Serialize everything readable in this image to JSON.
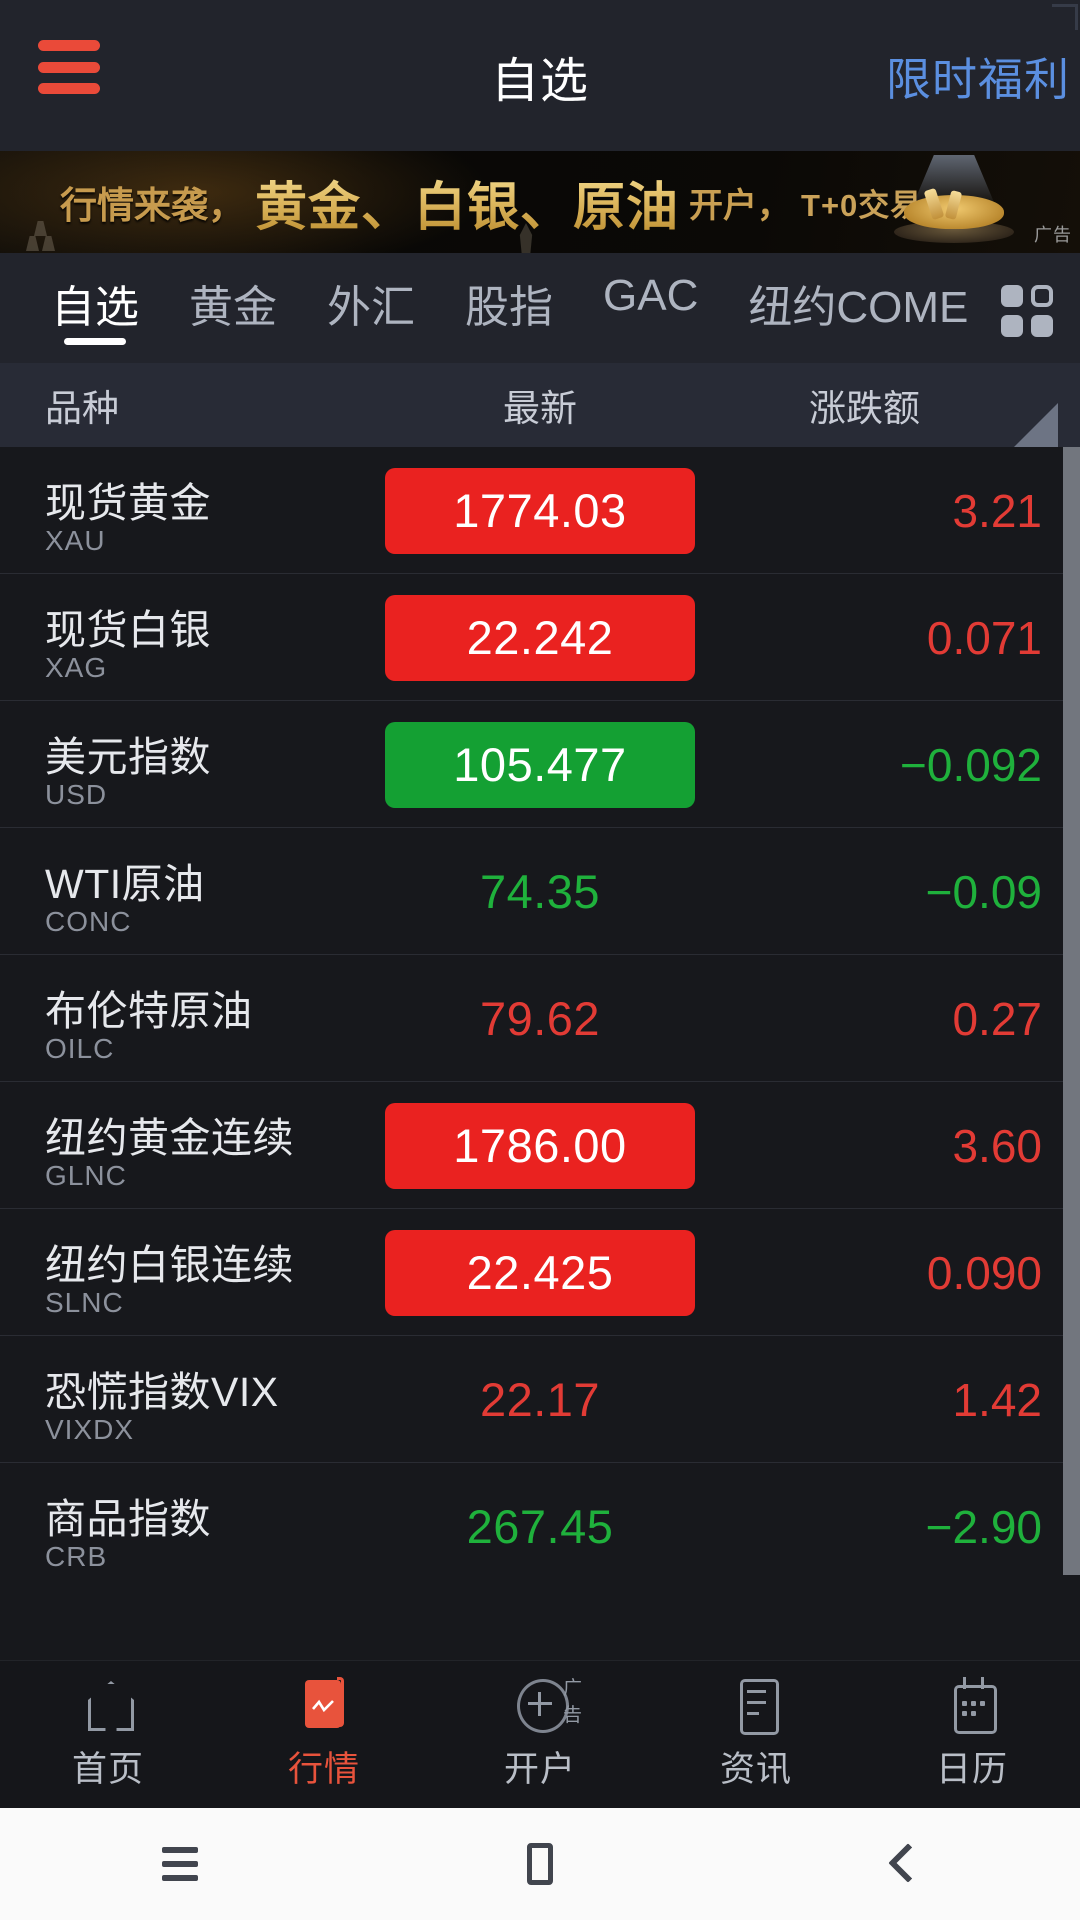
{
  "topbar": {
    "menu_icon": "hamburger-icon",
    "title": "自选",
    "promo_label": "限时福利"
  },
  "ad_banner": {
    "text_1": "行情来袭，",
    "text_2": "黄金、白银、原油",
    "text_3": "开户，",
    "text_4": "T+0交易",
    "badge": "广告"
  },
  "category_tabs": {
    "items": [
      {
        "label": "自选",
        "active": true
      },
      {
        "label": "黄金",
        "active": false
      },
      {
        "label": "外汇",
        "active": false
      },
      {
        "label": "股指",
        "active": false
      },
      {
        "label": "GAC",
        "active": false
      },
      {
        "label": "纽约COME",
        "active": false
      }
    ],
    "chevron": "›",
    "grid_icon": "grid-view-icon"
  },
  "table": {
    "headers": {
      "name": "品种",
      "last": "最新",
      "change": "涨跌额"
    },
    "rows": [
      {
        "name": "现货黄金",
        "code": "XAU",
        "price": "1774.03",
        "change": "3.21",
        "dir": "up",
        "pill": true
      },
      {
        "name": "现货白银",
        "code": "XAG",
        "price": "22.242",
        "change": "0.071",
        "dir": "up",
        "pill": true
      },
      {
        "name": "美元指数",
        "code": "USD",
        "price": "105.477",
        "change": "−0.092",
        "dir": "down",
        "pill": true
      },
      {
        "name": "WTI原油",
        "code": "CONC",
        "price": "74.35",
        "change": "−0.09",
        "dir": "down",
        "pill": false
      },
      {
        "name": "布伦特原油",
        "code": "OILC",
        "price": "79.62",
        "change": "0.27",
        "dir": "up",
        "pill": false
      },
      {
        "name": "纽约黄金连续",
        "code": "GLNC",
        "price": "1786.00",
        "change": "3.60",
        "dir": "up",
        "pill": true
      },
      {
        "name": "纽约白银连续",
        "code": "SLNC",
        "price": "22.425",
        "change": "0.090",
        "dir": "up",
        "pill": true
      },
      {
        "name": "恐慌指数VIX",
        "code": "VIXDX",
        "price": "22.17",
        "change": "1.42",
        "dir": "up",
        "pill": false
      },
      {
        "name": "商品指数",
        "code": "CRB",
        "price": "267.45",
        "change": "−2.90",
        "dir": "down",
        "pill": false
      }
    ]
  },
  "bottom_nav": {
    "items": [
      {
        "label": "首页",
        "icon": "home-icon",
        "active": false,
        "ad_tag": ""
      },
      {
        "label": "行情",
        "icon": "quotes-icon",
        "active": true,
        "ad_tag": ""
      },
      {
        "label": "开户",
        "icon": "plus-circle-icon",
        "active": false,
        "ad_tag": "广告"
      },
      {
        "label": "资讯",
        "icon": "news-icon",
        "active": false,
        "ad_tag": ""
      },
      {
        "label": "日历",
        "icon": "calendar-icon",
        "active": false,
        "ad_tag": ""
      }
    ]
  },
  "system_nav": {
    "recents": "recents-icon",
    "home": "home-square-icon",
    "back": "back-chevron-icon"
  },
  "colors": {
    "up": "#e23b35",
    "down": "#1fb13c",
    "pill_up": "#ea2220",
    "pill_down": "#14a033",
    "accent": "#e8533c",
    "link": "#5b8fe0",
    "bg": "#17181c",
    "bar_bg": "#22242c"
  }
}
